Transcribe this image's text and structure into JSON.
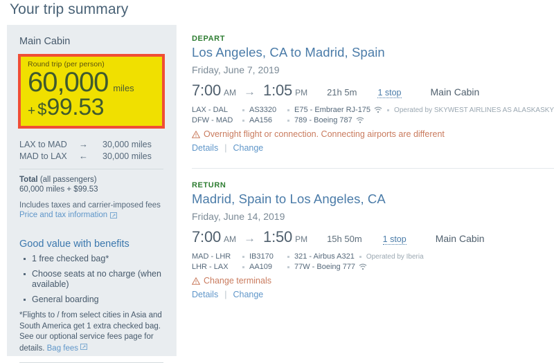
{
  "header": {
    "title": "Your trip summary"
  },
  "sidebar": {
    "cabin_name": "Main Cabin",
    "fare_box": {
      "label": "Round trip (per person)",
      "miles": "60,000",
      "miles_unit": "miles",
      "plus": "+",
      "currency": "$",
      "cash": "99.53",
      "border_color": "#F04E35",
      "background_color": "#F0E000"
    },
    "legs": [
      {
        "route": "LAX to MAD",
        "arrow": "→",
        "miles": "30,000 miles"
      },
      {
        "route": "MAD to LAX",
        "arrow": "←",
        "miles": "30,000 miles"
      }
    ],
    "total": {
      "label_bold": "Total",
      "label_rest": " (all passengers)",
      "value": "60,000 miles + $99.53"
    },
    "fees_note": "Includes taxes and carrier-imposed fees",
    "price_tax_link": "Price and tax information",
    "benefits_title": "Good value with benefits",
    "benefits": [
      "1 free checked bag*",
      "Choose seats at no charge (when available)",
      "General boarding"
    ],
    "footnote_text": "*Flights to / from select cities in Asia and South America get 1 extra checked bag. See our optional service fees page for details.",
    "bag_fees_link": "Bag fees"
  },
  "itineraries": [
    {
      "tag": "DEPART",
      "route": "Los Angeles, CA to Madrid, Spain",
      "date": "Friday, June 7, 2019",
      "depart_time": "7:00",
      "depart_meridiem": "AM",
      "arrow": "→",
      "arrive_time": "1:05",
      "arrive_meridiem": "PM",
      "duration": "21h 5m",
      "stops": "1 stop",
      "cabin": "Main Cabin",
      "segments": [
        {
          "airports": "LAX - DAL",
          "flight_no": "AS3320",
          "aircraft": "E75 - Embraer RJ-175",
          "wifi": true,
          "operated_by": "Operated by SKYWEST AIRLINES AS ALASKASKYWEST"
        },
        {
          "airports": "DFW - MAD",
          "flight_no": "AA156",
          "aircraft": "789 - Boeing 787",
          "wifi": true,
          "operated_by": ""
        }
      ],
      "warning": "Overnight flight or connection. Connecting airports are different",
      "details_label": "Details",
      "change_label": "Change"
    },
    {
      "tag": "RETURN",
      "route": "Madrid, Spain to Los Angeles, CA",
      "date": "Friday, June 14, 2019",
      "depart_time": "7:00",
      "depart_meridiem": "AM",
      "arrow": "→",
      "arrive_time": "1:50",
      "arrive_meridiem": "PM",
      "duration": "15h 50m",
      "stops": "1 stop",
      "cabin": "Main Cabin",
      "segments": [
        {
          "airports": "MAD - LHR",
          "flight_no": "IB3170",
          "aircraft": "321 - Airbus A321",
          "wifi": false,
          "operated_by": "Operated by Iberia"
        },
        {
          "airports": "LHR - LAX",
          "flight_no": "AA109",
          "aircraft": "77W - Boeing 777",
          "wifi": true,
          "operated_by": ""
        }
      ],
      "warning": "Change terminals",
      "details_label": "Details",
      "change_label": "Change"
    }
  ],
  "icons": {
    "external_link": "external-link-icon",
    "wifi": "wifi-icon",
    "warning": "warning-triangle-icon"
  }
}
